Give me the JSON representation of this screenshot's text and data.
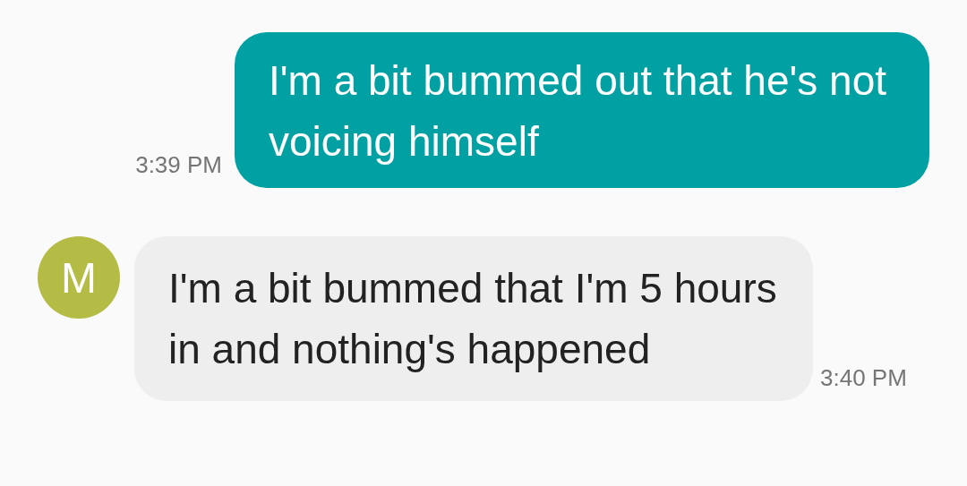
{
  "messages": [
    {
      "kind": "outgoing",
      "text": "I'm a bit bummed out that he's not voicing himself",
      "time": "3:39 PM"
    },
    {
      "kind": "incoming",
      "text": "I'm a bit bummed that I'm 5 hours in and nothing's happened",
      "time": "3:40 PM",
      "avatar": {
        "letter": "M",
        "color": "#b4bc45"
      }
    }
  ]
}
